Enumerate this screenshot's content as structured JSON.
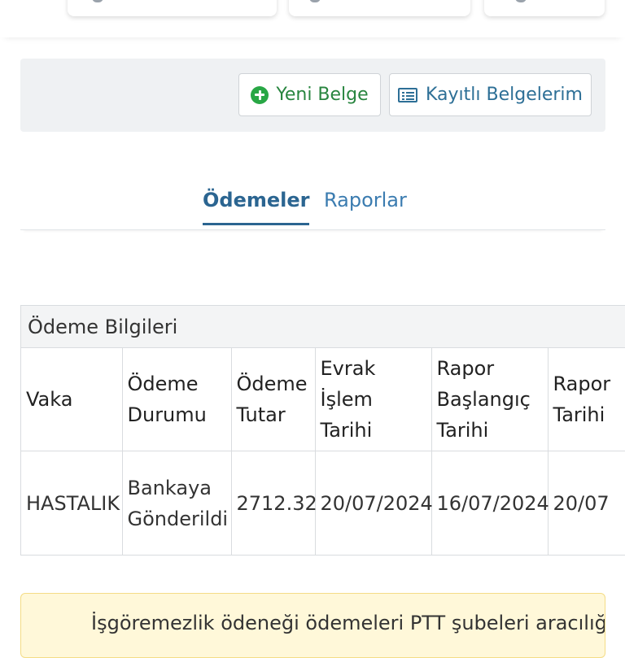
{
  "actions": {
    "new_document": "Yeni Belge",
    "saved_documents": "Kayıtlı Belgelerim"
  },
  "tabs": [
    "Ödemeler",
    "Raporlar"
  ],
  "payment_info": {
    "title": "Ödeme Bilgileri",
    "columns": [
      "Vaka",
      "Ödeme Durumu",
      "Ödeme Tutar",
      "Evrak İşlem Tarihi",
      "Rapor Başlangıç Tarihi",
      "Rapor Tarihi"
    ],
    "rows": [
      [
        "HASTALIK",
        "Bankaya Gönderildi",
        "2712.32",
        "20/07/2024",
        "16/07/2024",
        "20/07"
      ]
    ]
  },
  "alert": {
    "text": "İşgöremezlik ödeneği ödemeleri PTT şubeleri aracılığı ile"
  }
}
